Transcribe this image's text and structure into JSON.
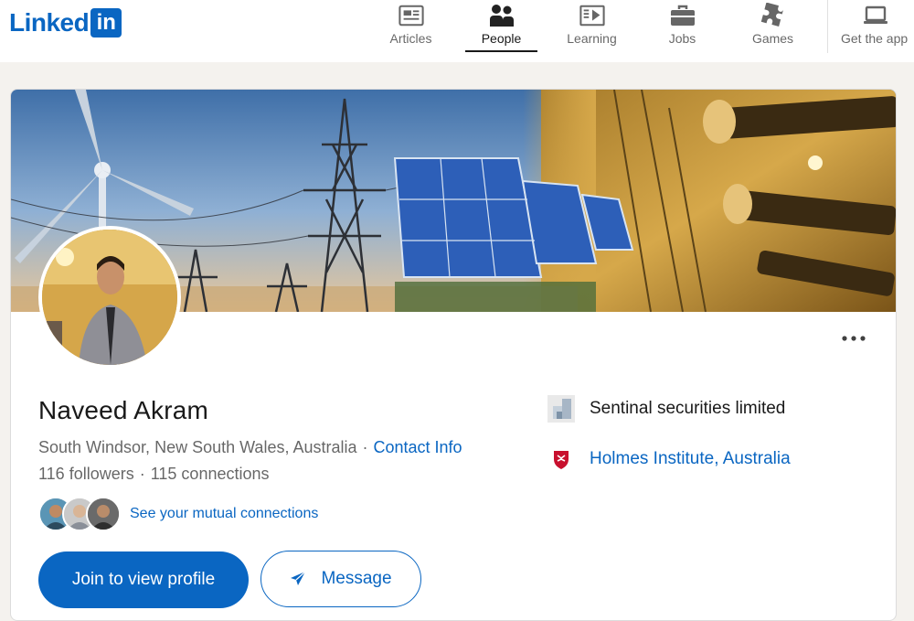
{
  "brand": {
    "logo_text": "Linked",
    "logo_box": "in",
    "color": "#0a66c2"
  },
  "nav": {
    "items": [
      {
        "label": "Articles",
        "icon": "articles-icon"
      },
      {
        "label": "People",
        "icon": "people-icon",
        "active": true
      },
      {
        "label": "Learning",
        "icon": "learning-icon"
      },
      {
        "label": "Jobs",
        "icon": "jobs-icon"
      },
      {
        "label": "Games",
        "icon": "games-icon"
      },
      {
        "label": "Get the app",
        "icon": "laptop-icon"
      }
    ]
  },
  "profile": {
    "name": "Naveed Akram",
    "location": "South Windsor, New South Wales, Australia",
    "contact_label": "Contact Info",
    "followers": "116 followers",
    "connections": "115 connections",
    "separator": "·",
    "mutual_label": "See your mutual connections",
    "more_icon": "ellipsis-icon"
  },
  "side": {
    "company": "Sentinal securities limited",
    "school": "Holmes Institute, Australia"
  },
  "actions": {
    "join_label": "Join to view profile",
    "message_label": "Message"
  }
}
